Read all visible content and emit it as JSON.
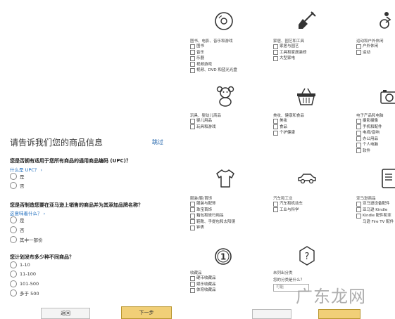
{
  "form": {
    "title": "请告诉我们您的商品信息",
    "skip": "跳过",
    "questions": [
      {
        "text": "您是否拥有适用于您所有商品的通用商品编码 (UPC)？",
        "hint": "什么是 UPC？ ›",
        "options": [
          "是",
          "否"
        ]
      },
      {
        "text": "您是否制造您要在亚马逊上销售的商品并为其添加品牌名称？",
        "hint": "这意味着什么？ ›",
        "options": [
          "是",
          "否",
          "其中一部份"
        ]
      },
      {
        "text": "您计划发布多少种不同商品？",
        "hint": "",
        "options": [
          "1-10",
          "11-100",
          "101-500",
          "多于 500"
        ]
      }
    ],
    "back_label": "返回",
    "next_label": "下一步"
  },
  "categories": [
    {
      "icon": "disc-icon",
      "title": "图书、电影、音乐和游戏",
      "items": [
        "图书",
        "音乐",
        "乐器",
        "视频游戏",
        "视频、DVD 和蓝光光盘"
      ]
    },
    {
      "icon": "shovel-icon",
      "title": "家居、园艺和工具",
      "items": [
        "家居与园艺",
        "工具和家居装修",
        "大型家电"
      ]
    },
    {
      "icon": "bicycle-icon",
      "title": "运动和户外休闲",
      "items": [
        "户外休闲",
        "运动"
      ]
    },
    {
      "icon": "teddy-bear-icon",
      "title": "玩具、婴幼儿商品",
      "items": [
        "婴儿用品",
        "玩具和游戏"
      ]
    },
    {
      "icon": "basket-icon",
      "title": "美妆、健康和食品",
      "items": [
        "美妆",
        "食品",
        "个护健康"
      ]
    },
    {
      "icon": "camera-icon",
      "title": "电子产品和电脑",
      "items": [
        "摄影摄像",
        "手机和配件",
        "电视/音响",
        "办公用品",
        "个人电脑",
        "软件"
      ]
    },
    {
      "icon": "shirt-icon",
      "title": "服装/鞋/首饰",
      "items": [
        "服装与配饰",
        "珠宝首饰",
        "箱包和旅行用品",
        "鞋靴、手提包和太阳镜",
        "钟表"
      ]
    },
    {
      "icon": "car-icon",
      "title": "汽车和工业",
      "items": [
        "汽车和机动车",
        "工业与科学"
      ]
    },
    {
      "icon": "tablet-icon",
      "title": "亚马逊商品",
      "items": [
        "亚马逊设备配件",
        "亚马逊 Kindle",
        "Kindle 配件和亚马逊 Fire TV 配件"
      ]
    },
    {
      "icon": "coin-icon",
      "title": "收藏品",
      "items": [
        "硬币收藏品",
        "娱乐收藏品",
        "体育收藏品"
      ]
    },
    {
      "icon": "question-icon",
      "title": "未列出分类",
      "items": [],
      "search_label": "您的分类是什么？",
      "search_placeholder": "可能"
    }
  ],
  "watermark": "广东龙网"
}
